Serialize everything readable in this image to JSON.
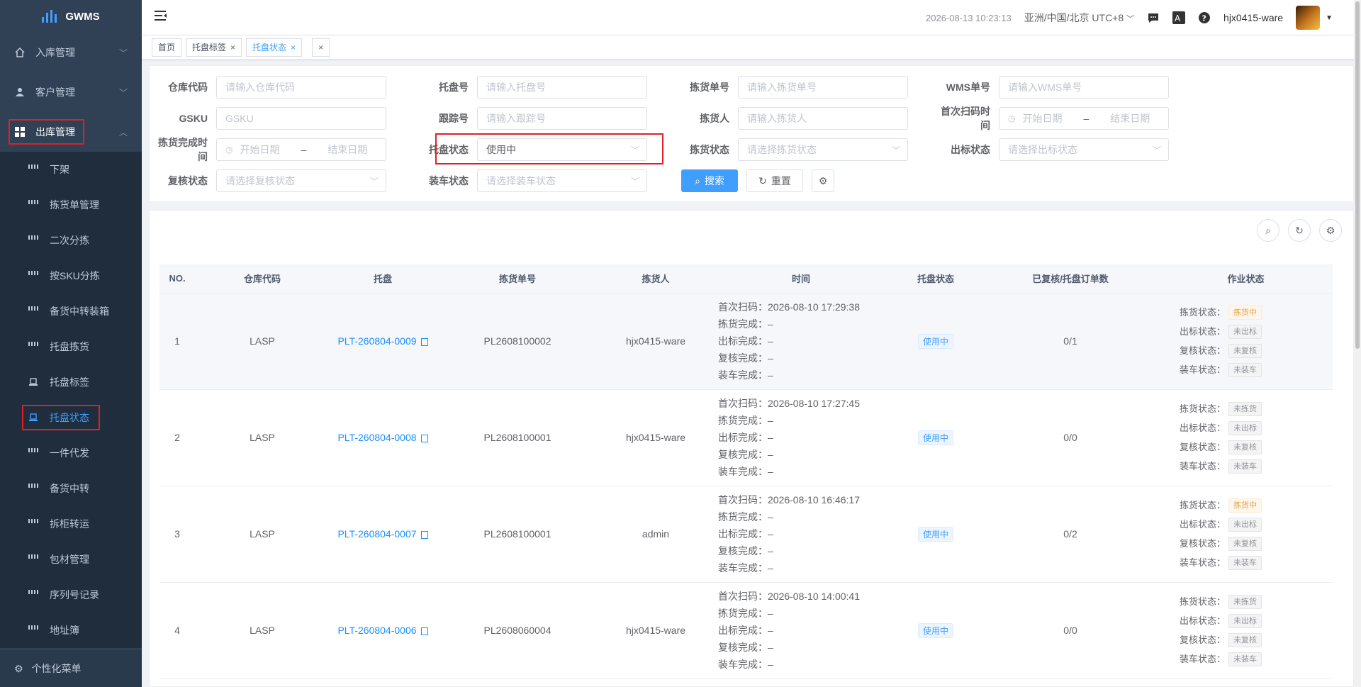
{
  "app": {
    "name": "GWMS"
  },
  "sidebar": {
    "groups": [
      {
        "label": "入库管理",
        "icon": "home-icon",
        "expanded": false
      },
      {
        "label": "客户管理",
        "icon": "user-icon",
        "expanded": false
      },
      {
        "label": "出库管理",
        "icon": "grid-icon",
        "expanded": true
      }
    ],
    "subitems": [
      {
        "label": "下架",
        "icon": "grid-icon"
      },
      {
        "label": "拣货单管理",
        "icon": "grid-icon"
      },
      {
        "label": "二次分拣",
        "icon": "grid-icon"
      },
      {
        "label": "按SKU分拣",
        "icon": "grid-icon"
      },
      {
        "label": "备货中转装箱",
        "icon": "grid-icon"
      },
      {
        "label": "托盘拣货",
        "icon": "grid-icon"
      },
      {
        "label": "托盘标签",
        "icon": "laptop-icon"
      },
      {
        "label": "托盘状态",
        "icon": "laptop-icon",
        "active": true
      },
      {
        "label": "一件代发",
        "icon": "grid-icon"
      },
      {
        "label": "备货中转",
        "icon": "grid-icon"
      },
      {
        "label": "拆柜转运",
        "icon": "grid-icon"
      },
      {
        "label": "包材管理",
        "icon": "grid-icon"
      },
      {
        "label": "序列号记录",
        "icon": "grid-icon"
      },
      {
        "label": "地址簿",
        "icon": "grid-icon"
      }
    ],
    "footer": "个性化菜单"
  },
  "header": {
    "datetime": "2026-08-13 10:23:13",
    "timezone": "亚洲/中国/北京 UTC+8",
    "username": "hjx0415-ware"
  },
  "tabs": [
    {
      "label": "首页",
      "closable": false,
      "active": false
    },
    {
      "label": "托盘标签",
      "closable": true,
      "active": false
    },
    {
      "label": "托盘状态",
      "closable": true,
      "active": true
    }
  ],
  "filters": {
    "warehouse_code": {
      "label": "仓库代码",
      "placeholder": "请输入仓库代码"
    },
    "pallet_no": {
      "label": "托盘号",
      "placeholder": "请输入托盘号"
    },
    "pick_no": {
      "label": "拣货单号",
      "placeholder": "请输入拣货单号"
    },
    "wms_no": {
      "label": "WMS单号",
      "placeholder": "请输入WMS单号"
    },
    "gsku": {
      "label": "GSKU",
      "placeholder": "GSKU"
    },
    "tracking_no": {
      "label": "跟踪号",
      "placeholder": "请输入跟踪号"
    },
    "picker": {
      "label": "拣货人",
      "placeholder": "请输入拣货人"
    },
    "first_scan": {
      "label": "首次扫码时间",
      "start": "开始日期",
      "sep": "–",
      "end": "结束日期"
    },
    "pick_done_time": {
      "label": "拣货完成时间",
      "start": "开始日期",
      "sep": "–",
      "end": "结束日期"
    },
    "pallet_status": {
      "label": "托盘状态",
      "value": "使用中"
    },
    "pick_status": {
      "label": "拣货状态",
      "placeholder": "请选择拣货状态"
    },
    "label_status": {
      "label": "出标状态",
      "placeholder": "请选择出标状态"
    },
    "recheck_status": {
      "label": "复核状态",
      "placeholder": "请选择复核状态"
    },
    "loading_status": {
      "label": "装车状态",
      "placeholder": "请选择装车状态"
    },
    "search_btn": "搜索",
    "reset_btn": "重置"
  },
  "table": {
    "columns": [
      "NO.",
      "仓库代码",
      "托盘",
      "拣货单号",
      "拣货人",
      "时间",
      "托盘状态",
      "已复核/托盘订单数",
      "作业状态"
    ],
    "time_labels": [
      "首次扫码：",
      "拣货完成：",
      "出标完成：",
      "复核完成：",
      "装车完成："
    ],
    "op_labels": [
      "拣货状态：",
      "出标状态：",
      "复核状态：",
      "装车状态："
    ],
    "rows": [
      {
        "no": "1",
        "warehouse": "LASP",
        "pallet": "PLT-260804-0009",
        "pick_no": "PL2608100002",
        "picker": "hjx0415-ware",
        "times": [
          "2026-08-10 17:29:38",
          "–",
          "–",
          "–",
          "–"
        ],
        "pallet_status": "使用中",
        "count": "0/1",
        "ops": [
          {
            "text": "拣货中",
            "style": "orange"
          },
          {
            "text": "未出标",
            "style": "gray"
          },
          {
            "text": "未复核",
            "style": "gray"
          },
          {
            "text": "未装车",
            "style": "gray"
          }
        ]
      },
      {
        "no": "2",
        "warehouse": "LASP",
        "pallet": "PLT-260804-0008",
        "pick_no": "PL2608100001",
        "picker": "hjx0415-ware",
        "times": [
          "2026-08-10 17:27:45",
          "–",
          "–",
          "–",
          "–"
        ],
        "pallet_status": "使用中",
        "count": "0/0",
        "ops": [
          {
            "text": "未拣货",
            "style": "gray"
          },
          {
            "text": "未出标",
            "style": "gray"
          },
          {
            "text": "未复核",
            "style": "gray"
          },
          {
            "text": "未装车",
            "style": "gray"
          }
        ]
      },
      {
        "no": "3",
        "warehouse": "LASP",
        "pallet": "PLT-260804-0007",
        "pick_no": "PL2608100001",
        "picker": "admin",
        "times": [
          "2026-08-10 16:46:17",
          "–",
          "–",
          "–",
          "–"
        ],
        "pallet_status": "使用中",
        "count": "0/2",
        "ops": [
          {
            "text": "拣货中",
            "style": "orange"
          },
          {
            "text": "未出标",
            "style": "gray"
          },
          {
            "text": "未复核",
            "style": "gray"
          },
          {
            "text": "未装车",
            "style": "gray"
          }
        ]
      },
      {
        "no": "4",
        "warehouse": "LASP",
        "pallet": "PLT-260804-0006",
        "pick_no": "PL2608060004",
        "picker": "hjx0415-ware",
        "times": [
          "2026-08-10 14:00:41",
          "–",
          "–",
          "–",
          "–"
        ],
        "pallet_status": "使用中",
        "count": "0/0",
        "ops": [
          {
            "text": "未拣货",
            "style": "gray"
          },
          {
            "text": "未出标",
            "style": "gray"
          },
          {
            "text": "未复核",
            "style": "gray"
          },
          {
            "text": "未装车",
            "style": "gray"
          }
        ]
      }
    ]
  },
  "colors": {
    "sidebar_bg": "#304156",
    "submenu_bg": "#1f2d3d",
    "primary": "#409eff",
    "highlight_border": "#e01f26"
  }
}
